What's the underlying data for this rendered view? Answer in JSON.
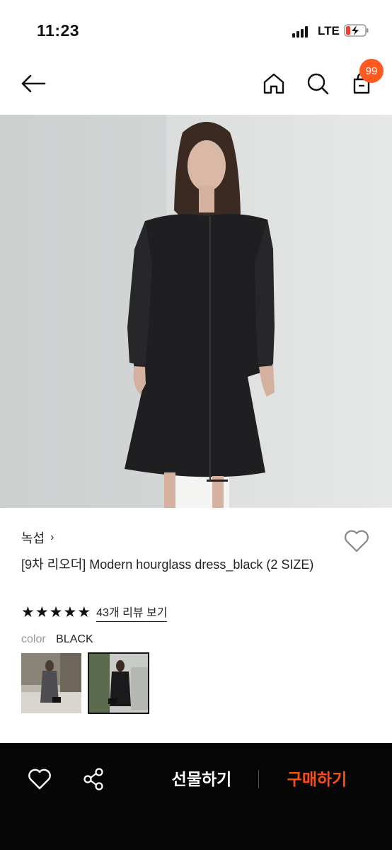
{
  "status": {
    "time": "11:23",
    "network": "LTE"
  },
  "header": {
    "cart_count": "99"
  },
  "product": {
    "brand": "녹섭",
    "brand_chevron": "›",
    "title": "[9차 리오더] Modern hourglass dress_black (2 SIZE)",
    "rating": 5,
    "review_link": "43개 리뷰 보기",
    "color_label": "color",
    "color_value": "BLACK"
  },
  "bottom": {
    "gift_label": "선물하기",
    "buy_label": "구매하기"
  },
  "colors": {
    "accent": "#ff5a1f",
    "buy": "#ff4d12",
    "bottom_bg": "#050505"
  },
  "icons": [
    "back-arrow-icon",
    "home-icon",
    "search-icon",
    "shopping-bag-icon",
    "heart-icon",
    "share-icon"
  ]
}
